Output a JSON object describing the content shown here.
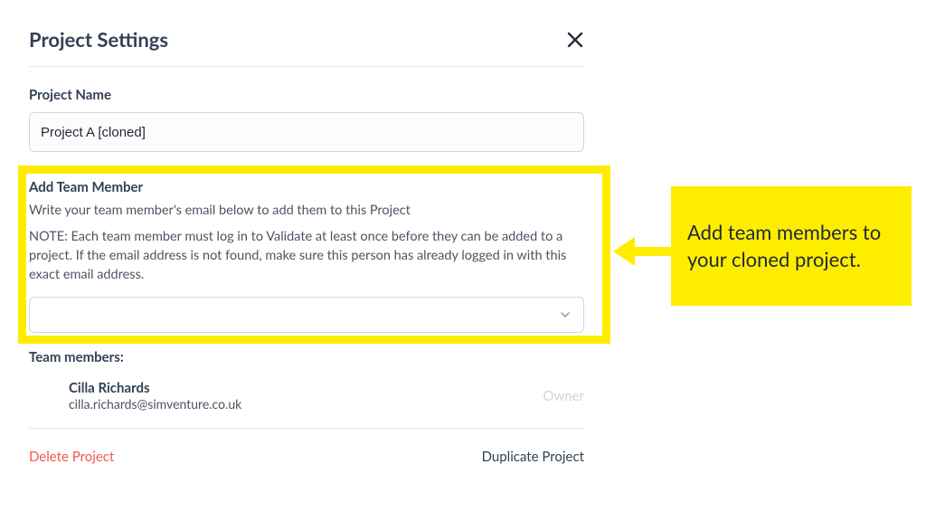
{
  "header": {
    "title": "Project Settings"
  },
  "project_name": {
    "label": "Project Name",
    "value": "Project A [cloned]"
  },
  "add_member": {
    "label": "Add Team Member",
    "helper": "Write your team member's email below to add them to this Project",
    "note": "NOTE: Each team member must log in to Validate at least once before they can be added to a project. If the email address is not found, make sure this person has already logged in with this exact email address."
  },
  "team": {
    "label": "Team members:",
    "members": [
      {
        "name": "Cilla Richards",
        "email": "cilla.richards@simventure.co.uk",
        "role": "Owner"
      }
    ]
  },
  "footer": {
    "delete": "Delete Project",
    "duplicate": "Duplicate Project"
  },
  "callout": {
    "text": "Add team members to your cloned project."
  }
}
